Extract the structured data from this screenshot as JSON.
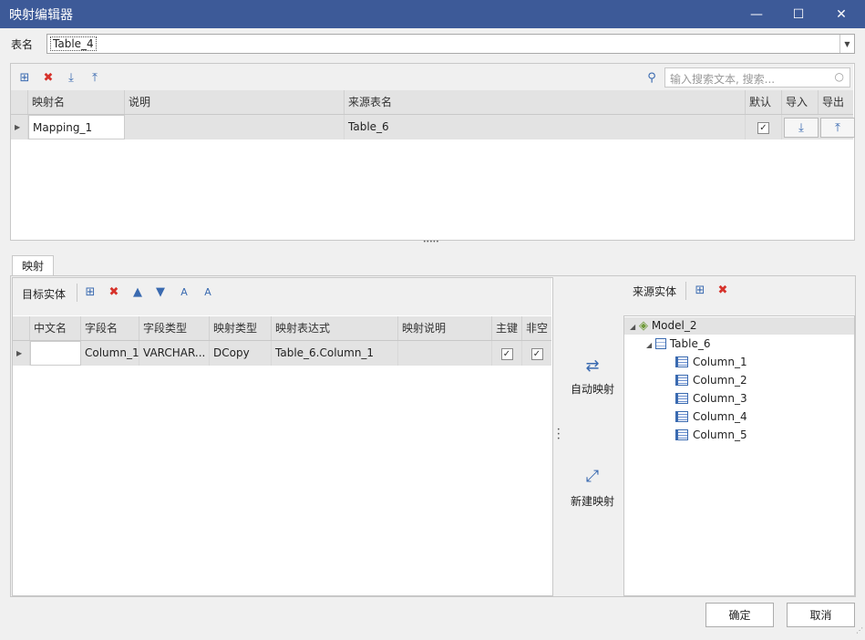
{
  "window": {
    "title": "映射编辑器",
    "min_icon": "minimize-icon",
    "max_icon": "maximize-icon",
    "close_icon": "close-icon"
  },
  "table_name": {
    "label": "表名",
    "value": "Table_4"
  },
  "top_toolbar": {
    "icons": [
      "add-mapping-icon",
      "delete-mapping-icon",
      "import-icon",
      "export-icon"
    ],
    "search_placeholder": "输入搜索文本, 搜索..."
  },
  "mapping_grid": {
    "headers": {
      "name": "映射名",
      "desc": "说明",
      "source": "来源表名",
      "default": "默认",
      "import": "导入",
      "export": "导出"
    },
    "rows": [
      {
        "name": "Mapping_1",
        "desc": "",
        "source": "Table_6",
        "default_checked": true
      }
    ]
  },
  "splitter_dots": "•••••",
  "tab": {
    "label": "映射"
  },
  "target": {
    "label": "目标实体",
    "headers": {
      "cn_name": "中文名",
      "field": "字段名",
      "field_type": "字段类型",
      "map_type": "映射类型",
      "expr": "映射表达式",
      "map_desc": "映射说明",
      "pk": "主键",
      "not_null": "非空"
    },
    "rows": [
      {
        "cn_name": "",
        "field": "Column_1",
        "field_type": "VARCHAR...",
        "map_type": "DCopy",
        "expr": "Table_6.Column_1",
        "map_desc": "",
        "pk": true,
        "not_null": true
      }
    ]
  },
  "actions": {
    "auto_map": "自动映射",
    "new_map": "新建映射"
  },
  "source": {
    "label": "来源实体",
    "model": "Model_2",
    "table": "Table_6",
    "columns": [
      "Column_1",
      "Column_2",
      "Column_3",
      "Column_4",
      "Column_5"
    ]
  },
  "footer": {
    "ok": "确定",
    "cancel": "取消"
  },
  "colors": {
    "titlebar": "#3d5a98",
    "accent": "#3a6ab0",
    "delete": "#d6322b"
  }
}
